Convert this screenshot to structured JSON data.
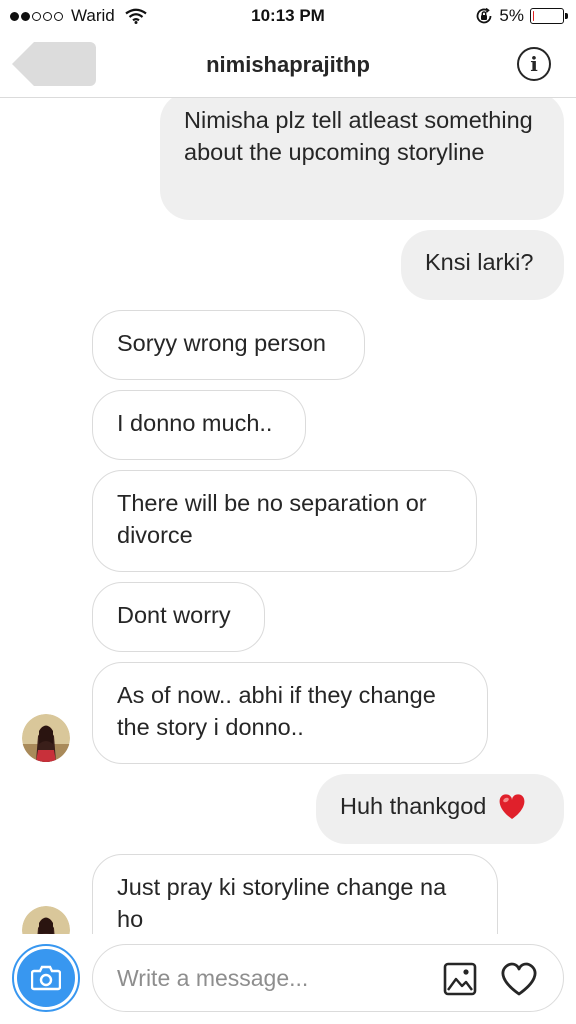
{
  "status_bar": {
    "carrier": "Warid",
    "time": "10:13 PM",
    "battery_percent": "5%",
    "battery_level": 0.05,
    "signal_bars_filled": 2,
    "signal_bars_total": 5
  },
  "header": {
    "title": "nimishaprajithp",
    "info_label": "i"
  },
  "messages": [
    {
      "direction": "outgoing",
      "text": "Nimisha plz tell atleast something about the upcoming storyline"
    },
    {
      "direction": "outgoing",
      "text": "Knsi larki?"
    },
    {
      "direction": "incoming",
      "text": "Soryy wrong person"
    },
    {
      "direction": "incoming",
      "text": "I donno much.."
    },
    {
      "direction": "incoming",
      "text": "There will be no separation or divorce"
    },
    {
      "direction": "incoming",
      "text": "Dont worry"
    },
    {
      "direction": "incoming",
      "text": "As of now.. abhi if they change the story i donno..",
      "avatar": true
    },
    {
      "direction": "outgoing",
      "text": "Huh thankgod",
      "emoji": "red-heart"
    },
    {
      "direction": "incoming",
      "text": "Just pray ki storyline change na ho",
      "avatar": true
    }
  ],
  "composer": {
    "placeholder": "Write a message..."
  },
  "colors": {
    "accent": "#3897f0",
    "outgoing_bubble": "#efefef",
    "incoming_border": "#dbdbdb",
    "heart": "#e0202b",
    "battery_low": "#e02424"
  },
  "icons": [
    "wifi-icon",
    "orientation-lock-icon",
    "battery-icon",
    "back-arrow-icon",
    "info-icon",
    "camera-icon",
    "gallery-icon",
    "heart-icon"
  ]
}
